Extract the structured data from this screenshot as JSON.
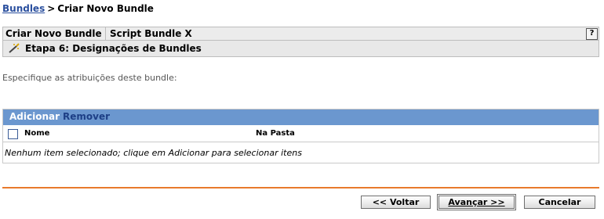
{
  "breadcrumb": {
    "link": "Bundles",
    "separator": ">",
    "current": "Criar Novo Bundle"
  },
  "wizard": {
    "title": "Criar Novo Bundle",
    "bundle_name": "Script Bundle X",
    "help_label": "?"
  },
  "step": {
    "icon": "wand-icon",
    "label": "Etapa 6: Designações de Bundles"
  },
  "instructions": "Especifique as atribuições deste bundle:",
  "table": {
    "actions": {
      "add": "Adicionar",
      "remove": "Remover"
    },
    "columns": [
      "Nome",
      "Na Pasta"
    ],
    "empty_message": "Nenhum item selecionado; clique em Adicionar para selecionar itens"
  },
  "buttons": {
    "back": "<< Voltar",
    "next": "Avançar >>",
    "cancel": "Cancelar"
  },
  "colors": {
    "toolbar_bg": "#6b97cf",
    "divider": "#e87a2c",
    "link": "#2a4f9e"
  }
}
